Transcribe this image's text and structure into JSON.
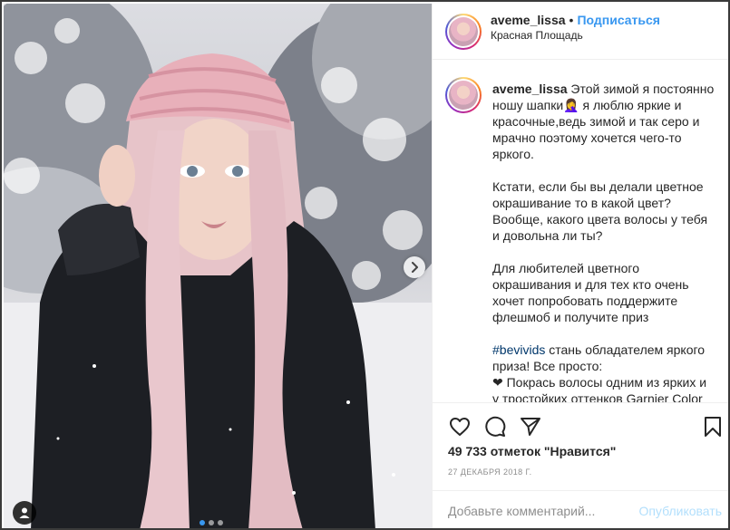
{
  "post": {
    "username": "aveme_lissa",
    "bullet": "•",
    "follow_label": "Подписаться",
    "location": "Красная Площадь"
  },
  "caption": {
    "username": "aveme_lissa",
    "p1": "Этой зимой я постоянно ношу шапки🤦‍♀️ я люблю яркие и красочные,ведь зимой и так серо и мрачно поэтому хочется чего-то яркого.",
    "p2": "Кстати, если бы вы делали цветное окрашивание то в какой цвет? Вообще, какого цвета волосы у тебя и довольна ли ты?",
    "p3": "Для любителей цветного окрашивания и для тех кто очень хочет попробовать поддержите флешмоб и получите приз",
    "hashtag": "#bevivids",
    "p4_rest": " стань обладателем яркого приза! Все просто:",
    "p5": "❤ Покрась волосы одним из ярких и у тростойких оттенков Garnier Color"
  },
  "stats": {
    "likes": "49 733 отметок \"Нравится\"",
    "date": "27 ДЕКАБРЯ 2018 Г."
  },
  "comment": {
    "placeholder": "Добавьте комментарий...",
    "publish_label": "Опубликовать"
  },
  "icons": {
    "like": "heart-icon",
    "comment": "comment-icon",
    "share": "share-icon",
    "save": "bookmark-icon",
    "next": "chevron-right-icon",
    "tag": "user-tag-icon"
  },
  "carousel": {
    "count": 3,
    "active_index": 0
  },
  "colors": {
    "accent": "#3897f0",
    "publish_disabled": "#b2dffc",
    "hashtag": "#00376b"
  }
}
